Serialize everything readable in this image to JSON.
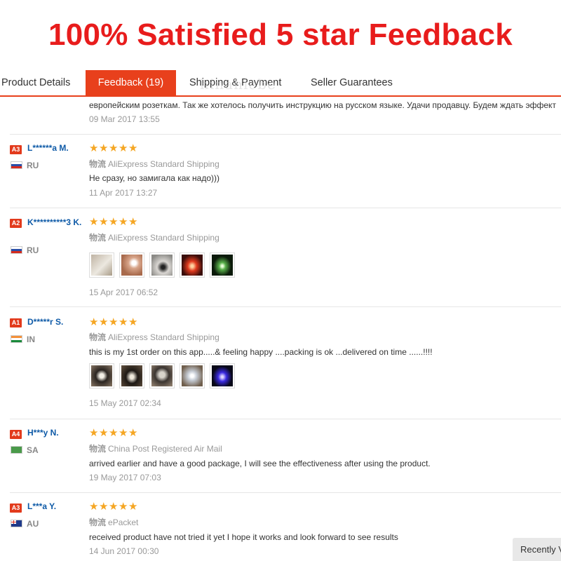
{
  "banner": {
    "title": "100% Satisfied 5 star Feedback"
  },
  "tabs": [
    {
      "label": "Product Details"
    },
    {
      "label": "Feedback (19)"
    },
    {
      "label": "Shipping & Payment"
    },
    {
      "label": "Seller Guarantees"
    }
  ],
  "watermark": "hinahiebe",
  "top_review": {
    "text": "европейским розеткам. Так же хотелось получить инструкцию на русском языке. Удачи продавцу. Будем ждать эффект",
    "date": "09 Mar 2017 13:55"
  },
  "shipping_prefix": "物流",
  "star_glyph": "★",
  "reviews": [
    {
      "level": "A3",
      "level_color": "#e23a1c",
      "name": "L******a M.",
      "country": "RU",
      "shipping": "AliExpress Standard Shipping",
      "comment": "Не сразу, но замигала как надо)))",
      "date": "11 Apr 2017 13:27",
      "rating": 5
    },
    {
      "level": "A2",
      "level_color": "#e23a1c",
      "name": "K**********3 K.",
      "country": "RU",
      "shipping": "AliExpress Standard Shipping",
      "comment": "",
      "date": "15 Apr 2017 06:52",
      "rating": 5,
      "photos": 5
    },
    {
      "level": "A1",
      "level_color": "#e23a1c",
      "name": "D*****r S.",
      "country": "IN",
      "shipping": "AliExpress Standard Shipping",
      "comment": "this is my 1st order on this app.....& feeling happy ....packing is ok ...delivered on time ......!!!!",
      "date": "15 May 2017 02:34",
      "rating": 5,
      "photos": 5
    },
    {
      "level": "A4",
      "level_color": "#e23a1c",
      "name": "H***y N.",
      "country": "SA",
      "shipping": "China Post Registered Air Mail",
      "comment": "arrived earlier and have a good package, I will see the effectiveness after using the product.",
      "date": "19 May 2017 07:03",
      "rating": 5
    },
    {
      "level": "A3",
      "level_color": "#e23a1c",
      "name": "L***a Y.",
      "country": "AU",
      "shipping": "ePacket",
      "comment": "received product have not tried it yet I hope it works and look forward to see results",
      "date": "14 Jun 2017 00:30",
      "rating": 5
    }
  ],
  "recently_viewed": "Recently Viewed",
  "colors": {
    "accent": "#e8401c",
    "banner_red": "#e81c1c",
    "star": "#f5a623",
    "name_blue": "#0e5aa7"
  }
}
